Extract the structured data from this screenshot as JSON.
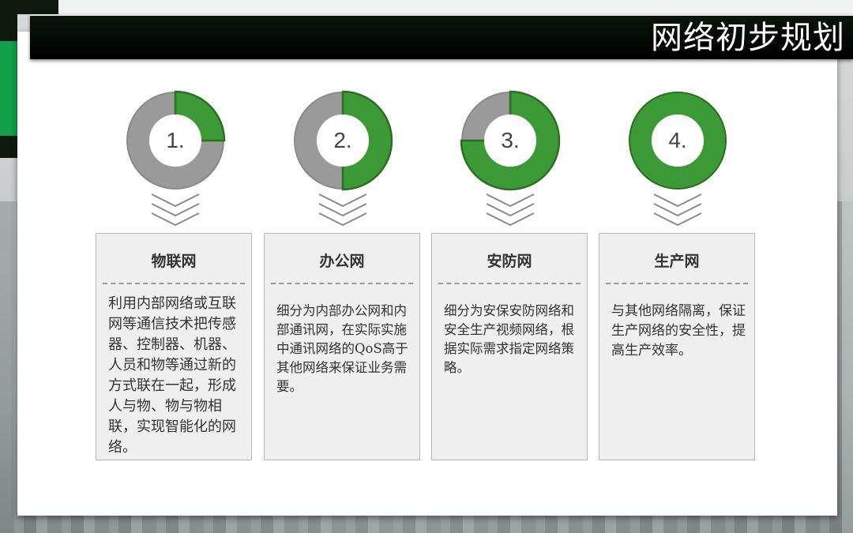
{
  "header": {
    "title": "网络初步规划"
  },
  "steps": [
    {
      "number": "1.",
      "fill_fraction": 0.25,
      "title": "物联网",
      "body": "利用内部网络或互联网等通信技术把传感器、控制器、机器、人员和物等通过新的方式联在一起，形成人与物、物与物相联，实现智能化的网络。"
    },
    {
      "number": "2.",
      "fill_fraction": 0.5,
      "title": "办公网",
      "body": "细分为内部办公网和内部通讯网，在实际实施中通讯网络的QoS高于其他网络来保证业务需要。"
    },
    {
      "number": "3.",
      "fill_fraction": 0.75,
      "title": "安防网",
      "body": "细分为安保安防网络和安全生产视频网络，根据实际需求指定网络策略。"
    },
    {
      "number": "4.",
      "fill_fraction": 1.0,
      "title": "生产网",
      "body": "与其他网络隔离，保证生产网络的安全性，提高生产效率。"
    }
  ],
  "colors": {
    "ring_green": "#3c9a36",
    "ring_green_stroke": "#2c6e22",
    "ring_grey": "#9a9a9a",
    "title_bar": "#000000",
    "accent_green": "#12a04a"
  },
  "icons": {
    "step_arrow": "triple-chevron-down-icon"
  }
}
